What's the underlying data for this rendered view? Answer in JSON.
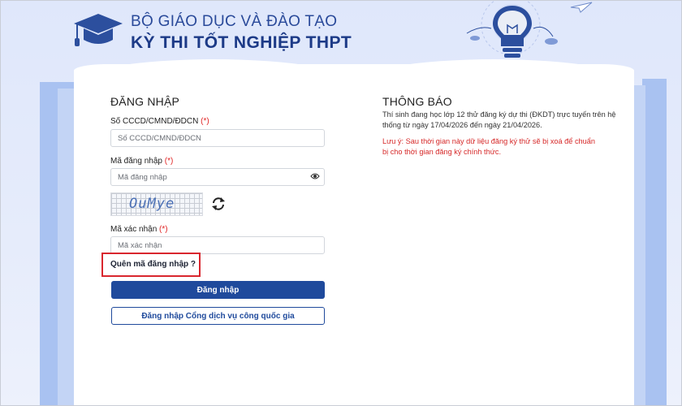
{
  "header": {
    "line1": "BỘ GIÁO DỤC VÀ ĐÀO TẠO",
    "line2": "KỲ THI TỐT NGHIỆP THPT"
  },
  "login": {
    "heading": "ĐĂNG NHẬP",
    "id_label": "Số CCCD/CMND/ĐDCN",
    "id_placeholder": "Số CCCD/CMND/ĐDCN",
    "code_label": "Mã đăng nhập",
    "code_placeholder": "Mã đăng nhập",
    "captcha_text": "OuMye",
    "verify_label": "Mã xác nhận",
    "verify_placeholder": "Mã xác nhận",
    "required_mark": "(*)",
    "forgot_link": "Quên mã đăng nhập ?",
    "login_button": "Đăng nhập",
    "portal_button": "Đăng nhập Cổng dịch vụ công quốc gia"
  },
  "notice": {
    "heading": "THÔNG BÁO",
    "body": "Thí sinh đang học lớp 12 thử đăng ký dự thi (ĐKDT) trực tuyến trên hệ thống từ ngày 17/04/2026 đến ngày 21/04/2026.",
    "warning": "Lưu ý: Sau thời gian này dữ liệu đăng ký thử sẽ bị xoá để chuẩn bị cho thời gian đăng ký chính thức."
  },
  "colors": {
    "brand_blue": "#1f4a9c",
    "alert_red": "#d62828",
    "highlight_red": "#d9262e"
  },
  "icons": {
    "logo": "graduation-cap-icon",
    "password_toggle": "eye-icon",
    "captcha_refresh": "refresh-icon"
  }
}
